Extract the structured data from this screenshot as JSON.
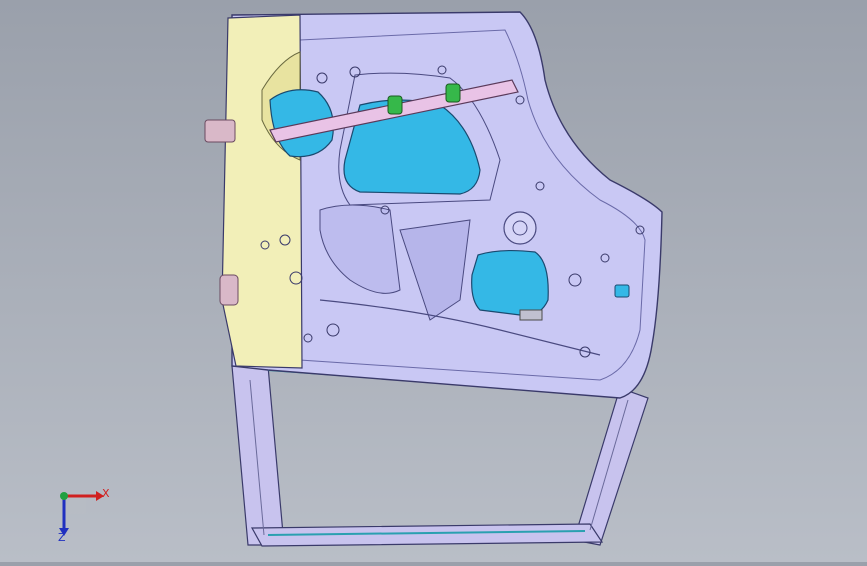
{
  "viewport": {
    "background_top": "#9aa0ab",
    "background_bottom": "#b9bec7"
  },
  "model": {
    "panel_fill": "#c9c8f4",
    "panel_stroke": "#3a3a6a",
    "hinge_fill": "#f2efb8",
    "opening_fill": "#34b8e6",
    "bar_fill": "#e9c3e6",
    "clip_fill": "#36b84a",
    "frame_fill": "#c8c3ee"
  },
  "triad": {
    "x_label": "X",
    "z_label": "Z",
    "x_color": "#d02020",
    "y_color": "#20a040",
    "z_color": "#2030c0"
  }
}
